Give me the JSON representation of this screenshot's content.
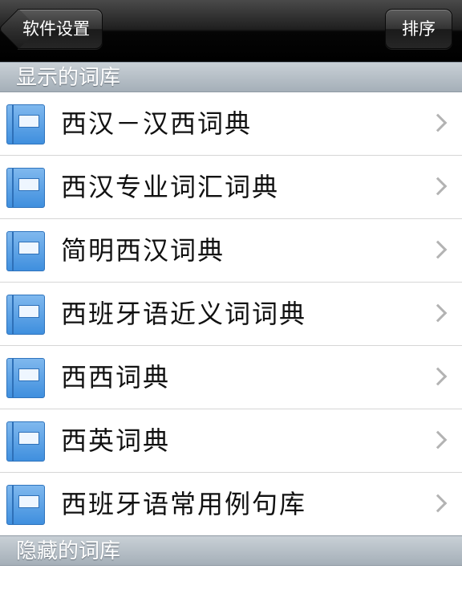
{
  "navbar": {
    "back_label": "软件设置",
    "sort_label": "排序"
  },
  "sections": {
    "shown_title": "显示的词库",
    "hidden_title": "隐藏的词库"
  },
  "dictionaries": [
    {
      "label": "西汉－汉西词典",
      "icon": "book-icon"
    },
    {
      "label": "西汉专业词汇词典",
      "icon": "book-icon"
    },
    {
      "label": "简明西汉词典",
      "icon": "book-icon"
    },
    {
      "label": "西班牙语近义词词典",
      "icon": "book-icon"
    },
    {
      "label": "西西词典",
      "icon": "book-icon"
    },
    {
      "label": "西英词典",
      "icon": "book-icon"
    },
    {
      "label": "西班牙语常用例句库",
      "icon": "book-icon"
    }
  ],
  "colors": {
    "navbar": "#000000",
    "section_header": "#b4bcc4",
    "icon_blue": "#4a97e2",
    "chevron": "#b3b3b3"
  }
}
